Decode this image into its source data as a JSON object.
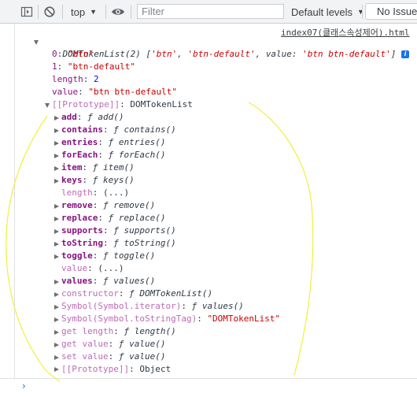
{
  "toolbar": {
    "context": "top",
    "filter_placeholder": "Filter",
    "levels": "Default levels",
    "issues": "No Issues"
  },
  "console": {
    "source_link": "index07(클래스속성제어).html",
    "header": {
      "type": "DOMTokenList(2)",
      "items": [
        "'btn'",
        "'btn-default'"
      ],
      "value_key": "value:",
      "value": "'btn btn-default'",
      "info": "i"
    },
    "props": [
      {
        "key": "0",
        "value": "\"btn\""
      },
      {
        "key": "1",
        "value": "\"btn-default\""
      },
      {
        "key": "length",
        "value": "2"
      },
      {
        "key": "value",
        "value": "\"btn btn-default\""
      }
    ],
    "prototype": {
      "label": "[[Prototype]]",
      "value": "DOMTokenList"
    },
    "proto_members": [
      {
        "key": "add",
        "fn": "add()"
      },
      {
        "key": "contains",
        "fn": "contains()"
      },
      {
        "key": "entries",
        "fn": "entries()"
      },
      {
        "key": "forEach",
        "fn": "forEach()"
      },
      {
        "key": "item",
        "fn": "item()"
      },
      {
        "key": "keys",
        "fn": "keys()"
      },
      {
        "key": "length",
        "getter": "(...)"
      },
      {
        "key": "remove",
        "fn": "remove()"
      },
      {
        "key": "replace",
        "fn": "replace()"
      },
      {
        "key": "supports",
        "fn": "supports()"
      },
      {
        "key": "toString",
        "fn": "toString()"
      },
      {
        "key": "toggle",
        "fn": "toggle()"
      },
      {
        "key": "value",
        "getter": "(...)"
      },
      {
        "key": "values",
        "fn": "values()"
      },
      {
        "key": "constructor",
        "fn": "DOMTokenList()"
      },
      {
        "key": "Symbol(Symbol.iterator)",
        "fn": "values()"
      },
      {
        "key": "Symbol(Symbol.toStringTag)",
        "str": "\"DOMTokenList\""
      },
      {
        "key": "get length",
        "fn": "length()"
      },
      {
        "key": "get value",
        "fn": "value()"
      },
      {
        "key": "set value",
        "fn": "value()"
      }
    ],
    "inner_prototype": {
      "label": "[[Prototype]]",
      "value": "Object"
    },
    "fn_symbol": "ƒ",
    "prompt": "›"
  },
  "colors": {
    "annotation": "#f2ef3a",
    "key": "#881280",
    "string": "#c80000",
    "number": "#1c00cf"
  }
}
